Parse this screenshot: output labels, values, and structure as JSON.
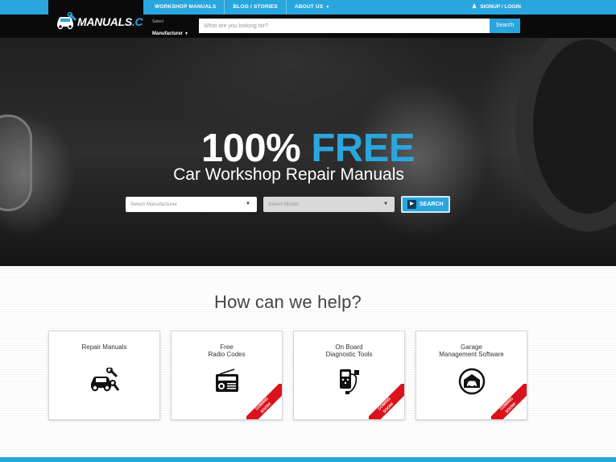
{
  "brand": {
    "name_part1": "MANUALS",
    "name_part2": ".CO",
    "accent_color": "#2aa6de"
  },
  "nav": {
    "items": [
      {
        "label": "WORKSHOP MANUALS"
      },
      {
        "label": "BLOG / STORIES"
      },
      {
        "label": "ABOUT US",
        "has_dropdown": true
      }
    ],
    "signup_label": "SIGNUP / LOGIN",
    "signup_icon": "user-icon"
  },
  "search": {
    "select_small_label": "Select",
    "select_value": "Manufacturer",
    "placeholder": "What are you looking for?",
    "button_label": "Search"
  },
  "hero": {
    "title_part1": "100%",
    "title_part2": "FREE",
    "subtitle": "Car Workshop Repair Manuals",
    "manufacturer_placeholder": "Select Manufacturer",
    "model_placeholder": "Select Model",
    "search_label": "SEARCH"
  },
  "help": {
    "title": "How can we help?",
    "cards": [
      {
        "label": "Repair Manuals",
        "icon": "car-wrench-icon",
        "coming_soon": ""
      },
      {
        "label": "Free\nRadio Codes",
        "icon": "radio-icon",
        "coming_soon": "COMING\nSOON!"
      },
      {
        "label": "On Board\nDiagnostic Tools",
        "icon": "obd-scanner-icon",
        "coming_soon": "COMING\nSOON!"
      },
      {
        "label": "Garage\nManagement Software",
        "icon": "garage-icon",
        "coming_soon": "COMING\nSOON!"
      }
    ]
  },
  "colors": {
    "ribbon": "#d8131b",
    "dark_bar": "#0a0a0a"
  }
}
